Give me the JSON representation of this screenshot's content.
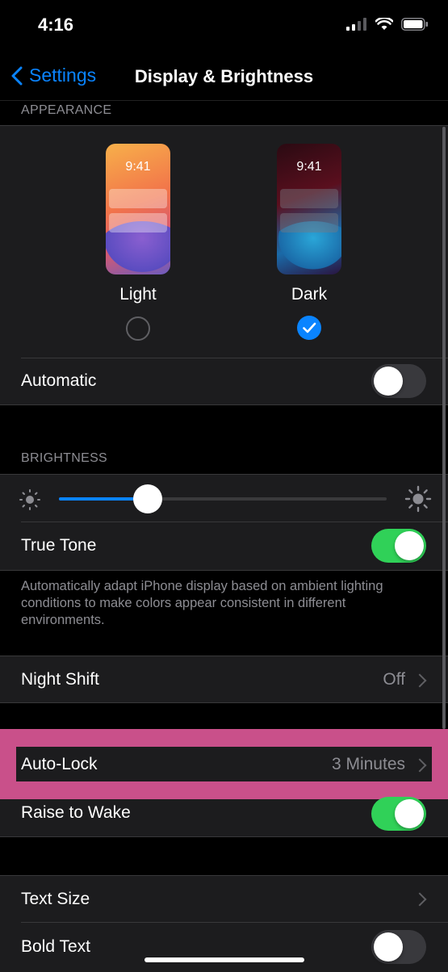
{
  "status_bar": {
    "time": "4:16"
  },
  "nav": {
    "back_label": "Settings",
    "title": "Display & Brightness"
  },
  "appearance": {
    "header": "APPEARANCE",
    "light": {
      "label": "Light",
      "time": "9:41",
      "selected": false
    },
    "dark": {
      "label": "Dark",
      "time": "9:41",
      "selected": true
    },
    "automatic": {
      "label": "Automatic",
      "on": false
    }
  },
  "brightness": {
    "header": "BRIGHTNESS",
    "level": 0.27,
    "true_tone": {
      "label": "True Tone",
      "on": true
    },
    "footer": "Automatically adapt iPhone display based on ambient lighting conditions to make colors appear consistent in different environments."
  },
  "night_shift": {
    "label": "Night Shift",
    "value": "Off"
  },
  "lock": {
    "auto_lock": {
      "label": "Auto-Lock",
      "value": "3 Minutes"
    },
    "raise_to_wake": {
      "label": "Raise to Wake",
      "on": true
    }
  },
  "text": {
    "text_size": {
      "label": "Text Size"
    },
    "bold_text": {
      "label": "Bold Text",
      "on": false
    }
  },
  "colors": {
    "accent": "#0a84ff",
    "toggle_on": "#30d158",
    "highlight": "#c9508a"
  }
}
